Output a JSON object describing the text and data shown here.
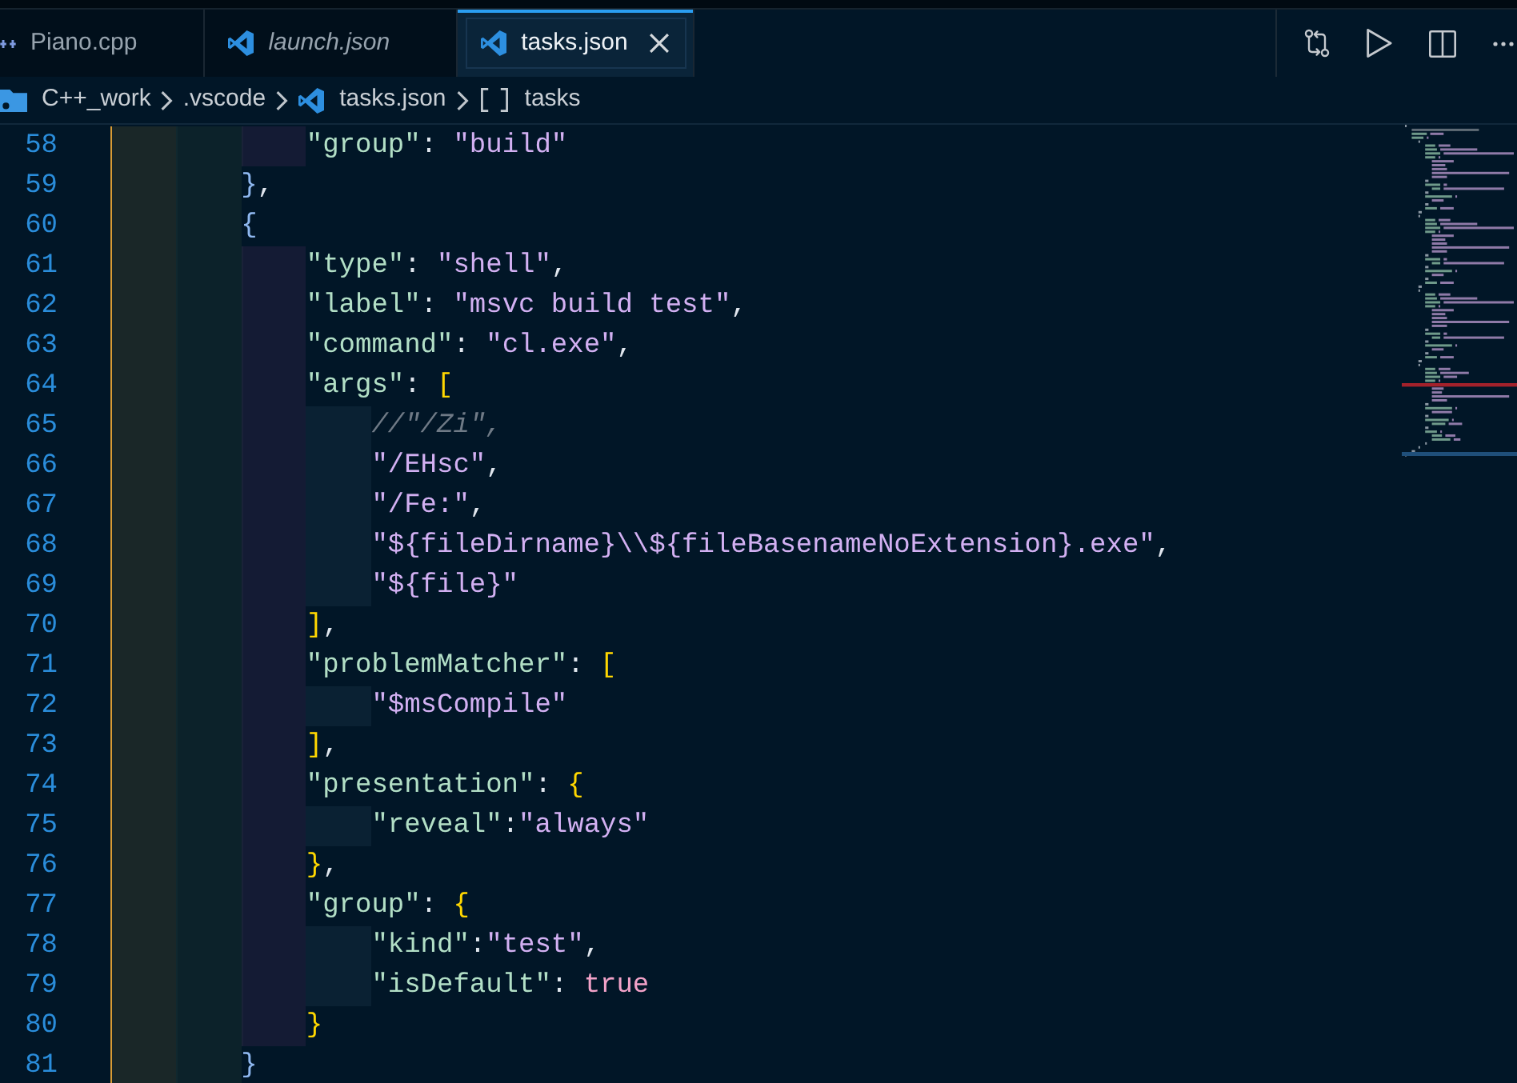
{
  "tabs": [
    {
      "label": "Piano.cpp",
      "kind": "cpp",
      "selected": false,
      "preview": false
    },
    {
      "label": "launch.json",
      "kind": "json",
      "selected": false,
      "preview": true
    },
    {
      "label": "tasks.json",
      "kind": "json",
      "selected": true,
      "preview": false
    }
  ],
  "breadcrumb": [
    {
      "kind": "root",
      "label": "C++_work"
    },
    {
      "kind": "folder",
      "label": ".vscode"
    },
    {
      "kind": "json",
      "label": "tasks.json"
    },
    {
      "kind": "array",
      "label": "tasks"
    }
  ],
  "editor": {
    "lines": [
      {
        "number": "58",
        "text": "            \"group\": \"build\""
      },
      {
        "number": "59",
        "text": "        },"
      },
      {
        "number": "60",
        "text": "        {"
      },
      {
        "number": "61",
        "text": "            \"type\": \"shell\","
      },
      {
        "number": "62",
        "text": "            \"label\": \"msvc build test\","
      },
      {
        "number": "63",
        "text": "            \"command\": \"cl.exe\","
      },
      {
        "number": "64",
        "text": "            \"args\": ["
      },
      {
        "number": "65",
        "text": "                //\"/Zi\","
      },
      {
        "number": "66",
        "text": "                \"/EHsc\","
      },
      {
        "number": "67",
        "text": "                \"/Fe:\","
      },
      {
        "number": "68",
        "text": "                \"${fileDirname}\\\\${fileBasenameNoExtension}.exe\","
      },
      {
        "number": "69",
        "text": "                \"${file}\""
      },
      {
        "number": "70",
        "text": "            ],"
      },
      {
        "number": "71",
        "text": "            \"problemMatcher\": ["
      },
      {
        "number": "72",
        "text": "                \"$msCompile\""
      },
      {
        "number": "73",
        "text": "            ],"
      },
      {
        "number": "74",
        "text": "            \"presentation\": {"
      },
      {
        "number": "75",
        "text": "                \"reveal\":\"always\""
      },
      {
        "number": "76",
        "text": "            },"
      },
      {
        "number": "77",
        "text": "            \"group\": {"
      },
      {
        "number": "78",
        "text": "                \"kind\":\"test\","
      },
      {
        "number": "79",
        "text": "                \"isDefault\": true"
      },
      {
        "number": "80",
        "text": "            }"
      },
      {
        "number": "81",
        "text": "        }"
      }
    ]
  }
}
